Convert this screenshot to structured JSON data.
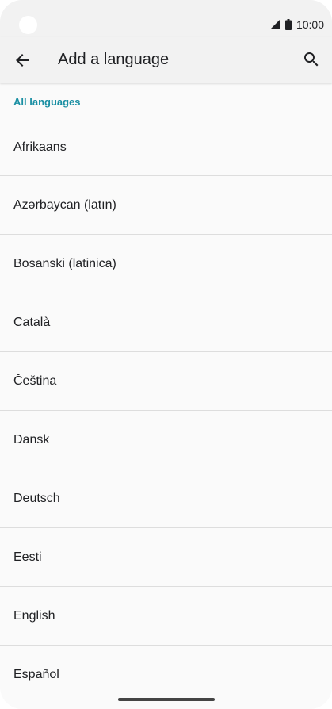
{
  "status_bar": {
    "time": "10:00",
    "icons": [
      "signal-icon",
      "battery-icon"
    ]
  },
  "app_bar": {
    "title": "Add a language",
    "back_icon": "arrow-back-icon",
    "search_icon": "search-icon"
  },
  "section": {
    "header": "All languages"
  },
  "languages": [
    "Afrikaans",
    "Azərbaycan (latın)",
    "Bosanski (latinica)",
    "Català",
    "Čeština",
    "Dansk",
    "Deutsch",
    "Eesti",
    "English",
    "Español"
  ],
  "colors": {
    "accent": "#1a8fa3",
    "background": "#fafafa",
    "app_bar": "#f2f2f2",
    "text": "#202124",
    "divider": "#dddddd"
  }
}
